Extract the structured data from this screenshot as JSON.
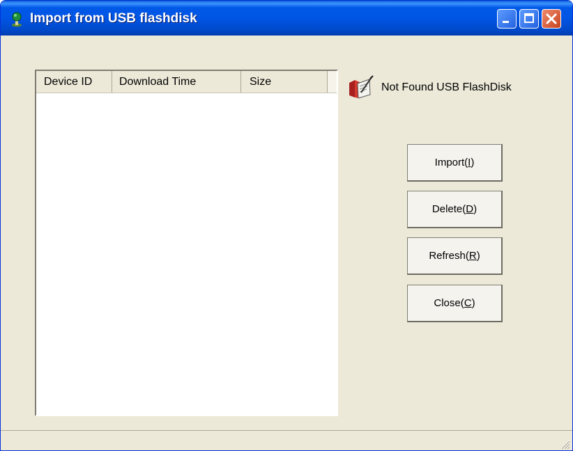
{
  "window": {
    "title": "Import from USB flashdisk",
    "controls": [
      "minimize",
      "maximize",
      "close"
    ],
    "colors": {
      "titlebar": "#0055e5",
      "face": "#ece9d8",
      "close": "#d8542e"
    }
  },
  "list": {
    "columns": [
      "Device ID",
      "Download Time",
      "Size"
    ],
    "rows": []
  },
  "status": {
    "icon": "usb-disk-icon",
    "text": "Not Found USB FlashDisk"
  },
  "buttons": {
    "import": {
      "label": "Import(",
      "key": "I",
      "close": ")"
    },
    "delete": {
      "label": "Delete(",
      "key": "D",
      "close": ")"
    },
    "refresh": {
      "label": "Refresh(",
      "key": "R",
      "close": ")"
    },
    "close": {
      "label": "Close(",
      "key": "C",
      "close": ")"
    }
  }
}
